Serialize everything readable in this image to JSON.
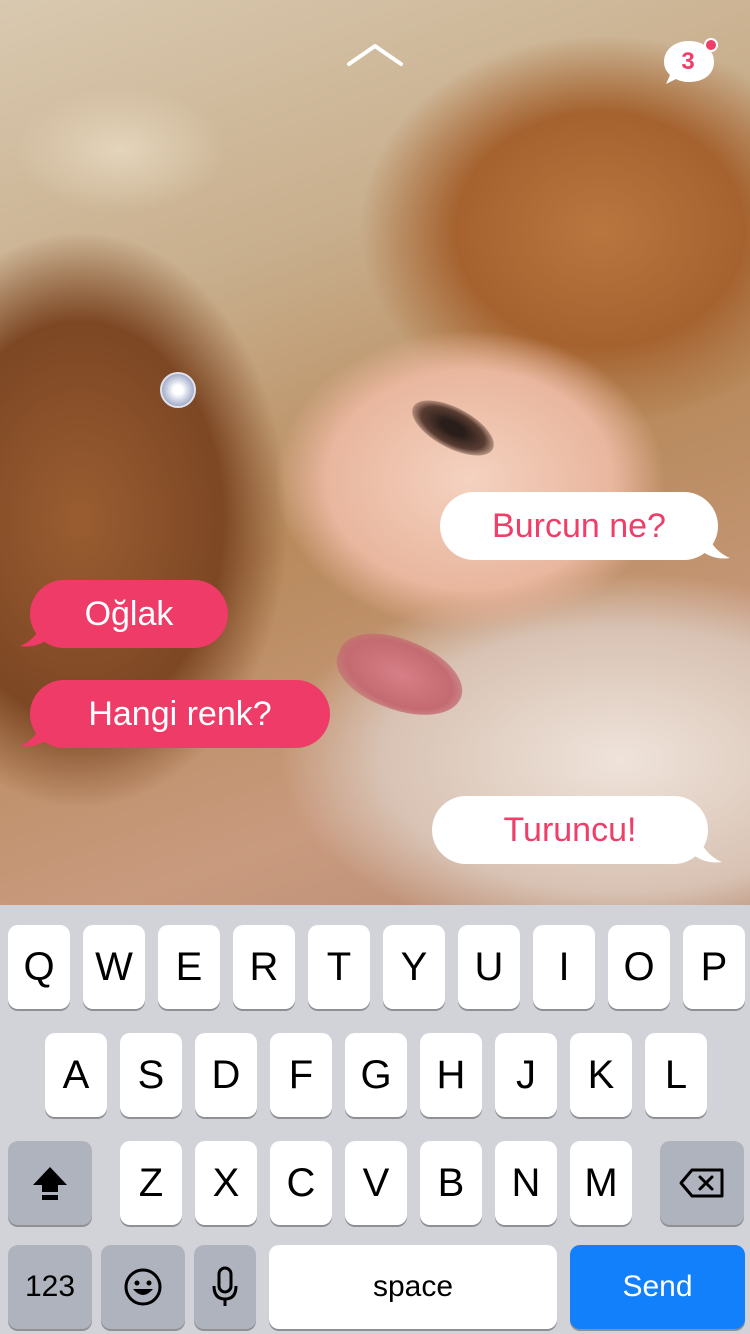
{
  "header": {
    "collapse_icon": "chevron-up-icon",
    "chat_icon": "chat-bubble-icon",
    "unread_count": "3",
    "accent_color": "#ee3e69"
  },
  "messages": [
    {
      "text": "Burcun ne?",
      "direction": "incoming"
    },
    {
      "text": "Oğlak",
      "direction": "outgoing"
    },
    {
      "text": "Hangi renk?",
      "direction": "outgoing"
    },
    {
      "text": "Turuncu!",
      "direction": "incoming"
    }
  ],
  "keyboard": {
    "row1": [
      "Q",
      "W",
      "E",
      "R",
      "T",
      "Y",
      "U",
      "I",
      "O",
      "P"
    ],
    "row2": [
      "A",
      "S",
      "D",
      "F",
      "G",
      "H",
      "J",
      "K",
      "L"
    ],
    "row3": [
      "Z",
      "X",
      "C",
      "V",
      "B",
      "N",
      "M"
    ],
    "shift_icon": "shift-icon",
    "backspace_icon": "backspace-icon",
    "numbers_label": "123",
    "emoji_icon": "emoji-icon",
    "mic_icon": "microphone-icon",
    "space_label": "space",
    "send_label": "Send",
    "send_color": "#1280fb"
  }
}
